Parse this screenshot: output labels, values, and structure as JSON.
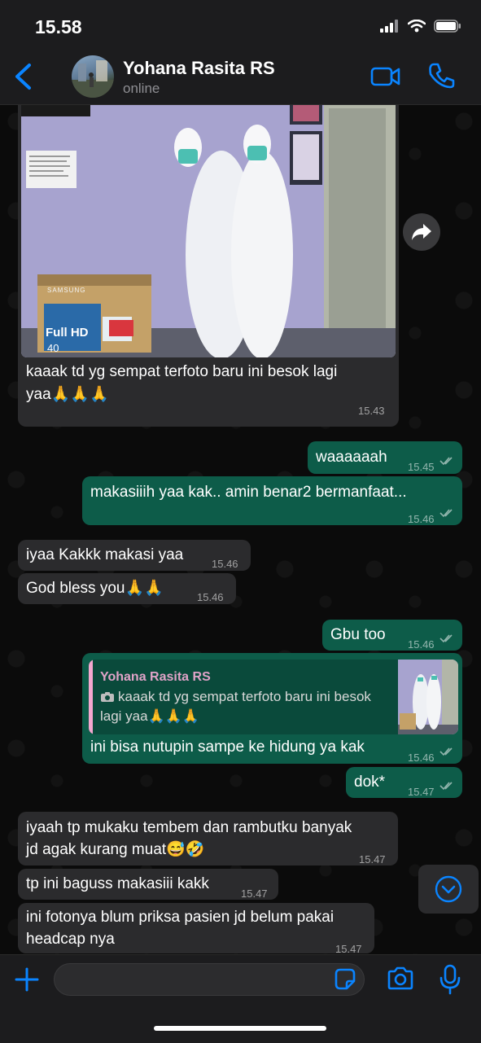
{
  "status_bar": {
    "time": "15.58"
  },
  "header": {
    "contact_name": "Yohana Rasita RS",
    "contact_status": "online"
  },
  "messages": [
    {
      "text_line1": "kaaak td yg sempat terfoto baru ini besok lagi",
      "text_line2": "yaa🙏🙏🙏",
      "time": "15.43"
    },
    {
      "text": "waaaaaah",
      "time": "15.45"
    },
    {
      "text": "makasiiih yaa kak.. amin benar2 bermanfaat...",
      "time": "15.46"
    },
    {
      "text": "iyaa Kakkk makasi yaa",
      "time": "15.46"
    },
    {
      "text": "God bless you🙏🙏",
      "time": "15.46"
    },
    {
      "text": "Gbu too",
      "time": "15.46"
    },
    {
      "quote_name": "Yohana Rasita RS",
      "quote_text": "kaaak td yg sempat terfoto baru ini besok lagi yaa🙏🙏🙏",
      "text": "ini bisa nutupin sampe ke hidung ya kak",
      "time": "15.46"
    },
    {
      "text": "dok*",
      "time": "15.47"
    },
    {
      "text_line1": "iyaah tp mukaku tembem dan rambutku banyak",
      "text_line2": "jd agak kurang muat😅🤣",
      "time": "15.47"
    },
    {
      "text": "tp ini baguss makasiii kakk",
      "time": "15.47"
    },
    {
      "text_line1": "ini fotonya blum priksa pasien jd belum pakai",
      "text_line2": "headcap nya",
      "time": "15.47"
    }
  ],
  "photo_text": {
    "monitor_brand": "SAMSUNG",
    "monitor_label": "Full HD",
    "monitor_size": "40"
  },
  "icons": {
    "back": "chevron-left-icon",
    "video": "video-camera-icon",
    "call": "phone-icon",
    "forward": "forward-icon",
    "scroll_down": "chevron-down-icon",
    "add": "plus-icon",
    "sticker": "sticker-icon",
    "camera": "camera-icon",
    "mic": "microphone-icon"
  },
  "colors": {
    "accent": "#0a84ff",
    "outgoing_bubble": "#0d5c49",
    "incoming_bubble": "#2b2b2d",
    "quote_name": "#e0a3c8"
  }
}
